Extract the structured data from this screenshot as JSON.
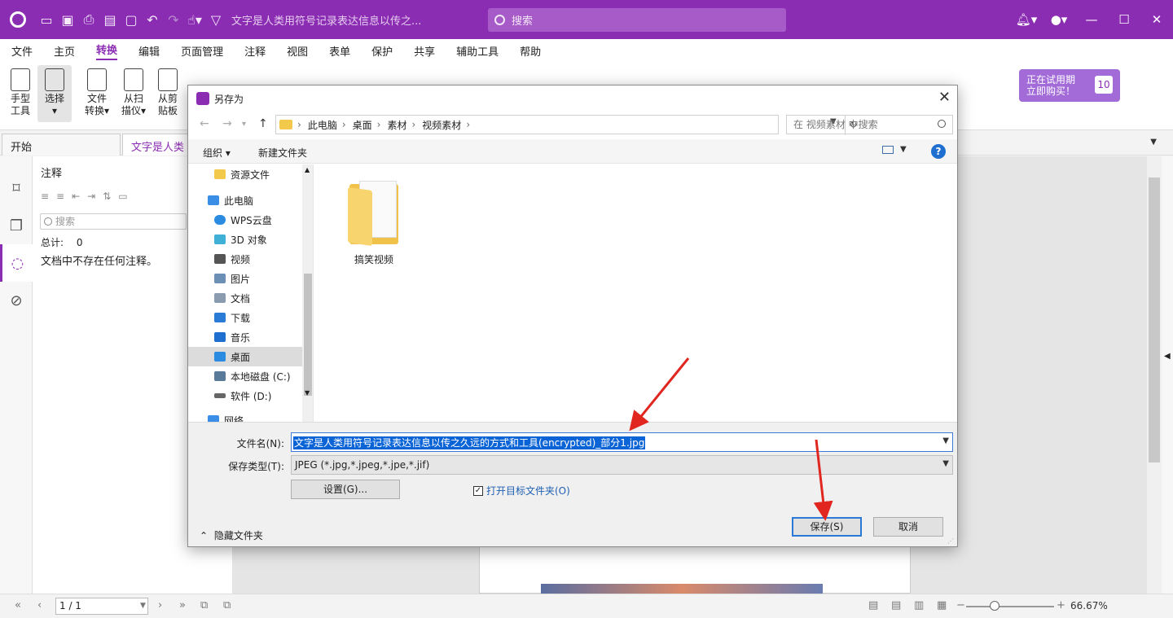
{
  "app": {
    "doc_title": "文字是人类用符号记录表达信息以传之...",
    "search_placeholder": "搜索"
  },
  "menu": [
    "文件",
    "主页",
    "转换",
    "编辑",
    "页面管理",
    "注释",
    "视图",
    "表单",
    "保护",
    "共享",
    "辅助工具",
    "帮助"
  ],
  "menu_active": "转换",
  "ribbon": {
    "hand_tool": [
      "手型",
      "工具"
    ],
    "select": [
      "选择",
      "▾"
    ],
    "file_convert": [
      "文件",
      "转换▾"
    ],
    "from_scan": [
      "从扫",
      "描仪▾"
    ],
    "from_clipboard": [
      "从剪",
      "贴板"
    ],
    "trial": {
      "line1": "正在试用期",
      "line2": "立即购买！",
      "days": "10"
    }
  },
  "tabs": {
    "start": "开始",
    "doc": "文字是人类用"
  },
  "annotation_panel": {
    "title": "注释",
    "search_placeholder": "搜索",
    "total_label": "总计:",
    "total_value": "0",
    "empty_message": "文档中不存在任何注释。"
  },
  "status": {
    "page": "1 / 1",
    "zoom": "66.67%"
  },
  "dialog": {
    "title": "另存为",
    "breadcrumbs": [
      "此电脑",
      "桌面",
      "素材",
      "视频素材"
    ],
    "search_placeholder": "在 视频素材 中搜索",
    "organize": "组织 ▾",
    "new_folder": "新建文件夹",
    "nav_items": [
      {
        "label": "资源文件",
        "color": "#f3c94b"
      },
      {
        "label": "此电脑",
        "color": "#3a8ee6"
      },
      {
        "label": "WPS云盘",
        "color": "#2a8be0"
      },
      {
        "label": "3D 对象",
        "color": "#3fb0d6"
      },
      {
        "label": "视频",
        "color": "#555555"
      },
      {
        "label": "图片",
        "color": "#6b8fb5"
      },
      {
        "label": "文档",
        "color": "#8a9bb0"
      },
      {
        "label": "下载",
        "color": "#2a7bd6"
      },
      {
        "label": "音乐",
        "color": "#1e6fd0"
      },
      {
        "label": "桌面",
        "color": "#2a8be0"
      },
      {
        "label": "本地磁盘 (C:)",
        "color": "#5a7a9a"
      },
      {
        "label": "软件 (D:)",
        "color": "#666666"
      },
      {
        "label": "网络",
        "color": "#3a8ee6"
      }
    ],
    "selected_nav": "桌面",
    "folder": "搞笑视频",
    "filename_label": "文件名(N):",
    "filename": "文字是人类用符号记录表达信息以传之久远的方式和工具(encrypted)_部分1.jpg",
    "filetype_label": "保存类型(T):",
    "filetype": "JPEG (*.jpg,*.jpeg,*.jpe,*.jif)",
    "settings_button": "设置(G)...",
    "open_folder_checkbox": "打开目标文件夹(O)",
    "open_folder_checked": true,
    "hide_folders": "隐藏文件夹",
    "save_button": "保存(S)",
    "cancel_button": "取消"
  },
  "colors": {
    "brand": "#8b2db3",
    "arrow": "#e0261f",
    "selection": "#0a64d6"
  }
}
